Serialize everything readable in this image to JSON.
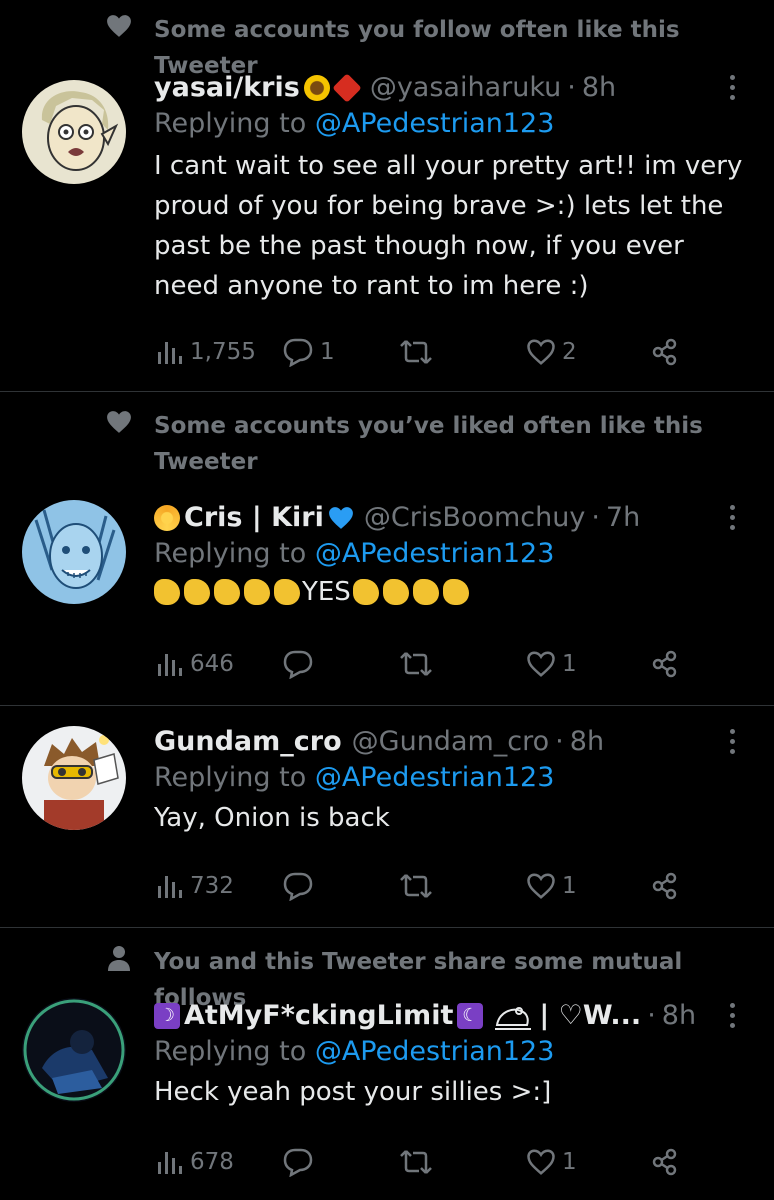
{
  "tweets": [
    {
      "social_context": "Some accounts you follow often like this Tweeter",
      "name": "yasai/kris",
      "name_emojis": [
        "sunflower-emoji",
        "maple-leaf-emoji"
      ],
      "handle": "@yasaiharuku",
      "time": "8h",
      "replying_prefix": "Replying to",
      "replying_to": "@APedestrian123",
      "text": "I cant wait to see all your pretty art!! im very proud of you for being brave >:) lets let the past be the past though now, if you ever need anyone to rant to im here :)",
      "views": "1,755",
      "replies": "1",
      "retweets": "",
      "likes": "2"
    },
    {
      "social_context": "Some accounts you’ve liked often like this Tweeter",
      "name": "Cris | Kiri",
      "name_emojis": [
        "dizzy-emoji",
        "blue-heart-emoji"
      ],
      "handle": "@CrisBoomchuy",
      "time": "7h",
      "replying_prefix": "Replying to",
      "replying_to": "@APedestrian123",
      "text": "YES",
      "views": "646",
      "replies": "",
      "retweets": "",
      "likes": "1"
    },
    {
      "social_context": "",
      "name": "Gundam_cro",
      "handle": "@Gundam_cro",
      "time": "8h",
      "replying_prefix": "Replying to",
      "replying_to": "@APedestrian123",
      "text": "Yay, Onion is back",
      "views": "732",
      "replies": "",
      "retweets": "",
      "likes": "1"
    },
    {
      "social_context": "You and this Tweeter share some mutual follows",
      "name": "AtMyF*ckingLimit",
      "name_suffix": "| ♡W...",
      "name_emojis": [
        "crescent-moon-emoji",
        "crescent-moon-emoji",
        "frog-emoji"
      ],
      "handle": "",
      "time": "8h",
      "replying_prefix": "Replying to",
      "replying_to": "@APedestrian123",
      "text": "Heck yeah post your sillies >:]",
      "views": "678",
      "replies": "",
      "retweets": "",
      "likes": "1"
    }
  ],
  "icons": {
    "heart_context": "heart-icon",
    "person_context": "person-icon",
    "views": "bar-chart-icon",
    "reply": "speech-bubble-icon",
    "retweet": "retweet-icon",
    "like": "heart-outline-icon",
    "share": "share-icon",
    "more": "more-dots-icon"
  },
  "colors": {
    "background": "#000000",
    "text": "#e7e9ea",
    "secondary": "#71767b",
    "link": "#1d9bf0",
    "divider": "#2f3336"
  }
}
